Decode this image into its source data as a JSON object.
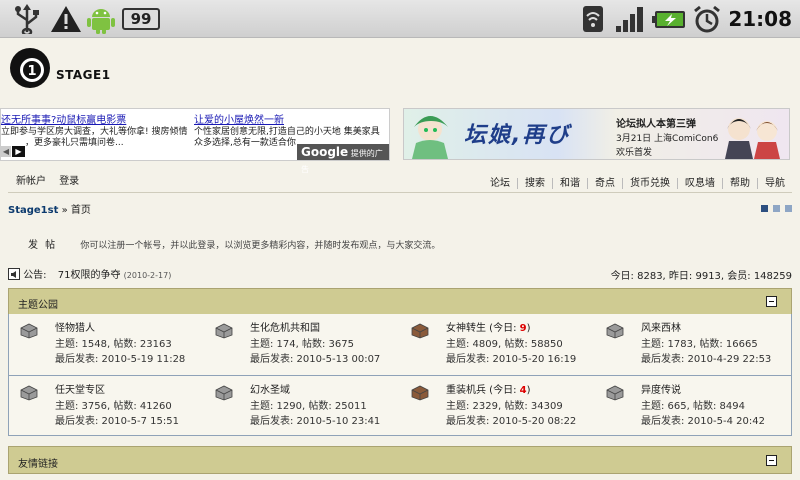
{
  "status_bar": {
    "icons": [
      "usb-icon",
      "warning-icon",
      "android-icon",
      "notification-count-icon",
      "wifi-icon",
      "signal-icon",
      "battery-charging-icon",
      "alarm-icon"
    ],
    "notification_count": "99",
    "time": "21:08"
  },
  "site": {
    "name": "STAGE1"
  },
  "ads": {
    "text_ad": {
      "col1_link": "还无所事事?动鼠标赢电影票",
      "col1_line2": "立即参与学区房大调查，大礼等你拿! 搜房倾情",
      "col1_line3": "，更多豪礼只需填问卷...",
      "col2_link": "让爱的小屋焕然一新",
      "col2_line2": "个性家居创意无限,打造自己的小天地 集美家具",
      "col2_line3": "众多选择,总有一款适合你",
      "google_brand": "Google",
      "google_label": "提供的广告"
    },
    "banner": {
      "title": "坛娘,再び",
      "line1": "论坛拟人本第三弹",
      "line2": "3月21日 上海ComiCon6",
      "line3": "欢乐首发"
    }
  },
  "userbar": {
    "register": "新帐户",
    "login": "登录"
  },
  "nav": [
    "论坛",
    "搜索",
    "和谐",
    "奇点",
    "货币兑换",
    "叹息墙",
    "帮助",
    "导航"
  ],
  "breadcrumb": {
    "site": "Stage1st",
    "sep": "»",
    "home": "首页"
  },
  "pager_colors": [
    "#2c4f80",
    "#8ea6c5",
    "#8ea6c5"
  ],
  "post": {
    "button": "发 帖",
    "description": "你可以注册一个帐号，并以此登录，以浏览更多精彩内容，并随时发布观点，与大家交流。"
  },
  "notice": {
    "label": "公告:",
    "title": "71权限的争夺",
    "date": "(2010-2-17)"
  },
  "stats": "今日: 8283, 昨日: 9913, 会员: 148259",
  "sections": {
    "topic_park": {
      "title": "主题公园"
    },
    "friend_links": {
      "title": "友情链接"
    }
  },
  "forums": [
    {
      "name": "怪物猎人",
      "today": "",
      "topics": "主题: 1548, 帖数: 23163",
      "last": "最后发表: 2010-5-19 11:28",
      "new": false
    },
    {
      "name": "生化危机共和国",
      "today": "",
      "topics": "主题: 174, 帖数: 3675",
      "last": "最后发表: 2010-5-13 00:07",
      "new": false
    },
    {
      "name": "女神转生",
      "today": "9",
      "topics": "主题: 4809, 帖数: 58850",
      "last": "最后发表: 2010-5-20 16:19",
      "new": true
    },
    {
      "name": "风来西林",
      "today": "",
      "topics": "主题: 1783, 帖数: 16665",
      "last": "最后发表: 2010-4-29 22:53",
      "new": false
    },
    {
      "name": "任天堂专区",
      "today": "",
      "topics": "主题: 3756, 帖数: 41260",
      "last": "最后发表: 2010-5-7 15:51",
      "new": false
    },
    {
      "name": "幻水圣域",
      "today": "",
      "topics": "主题: 1290, 帖数: 25011",
      "last": "最后发表: 2010-5-10 23:41",
      "new": false
    },
    {
      "name": "重装机兵",
      "today": "4",
      "topics": "主题: 2329, 帖数: 34309",
      "last": "最后发表: 2010-5-20 08:22",
      "new": true
    },
    {
      "name": "异度传说",
      "today": "",
      "topics": "主题: 665, 帖数: 8494",
      "last": "最后发表: 2010-5-4 20:42",
      "new": false
    }
  ]
}
